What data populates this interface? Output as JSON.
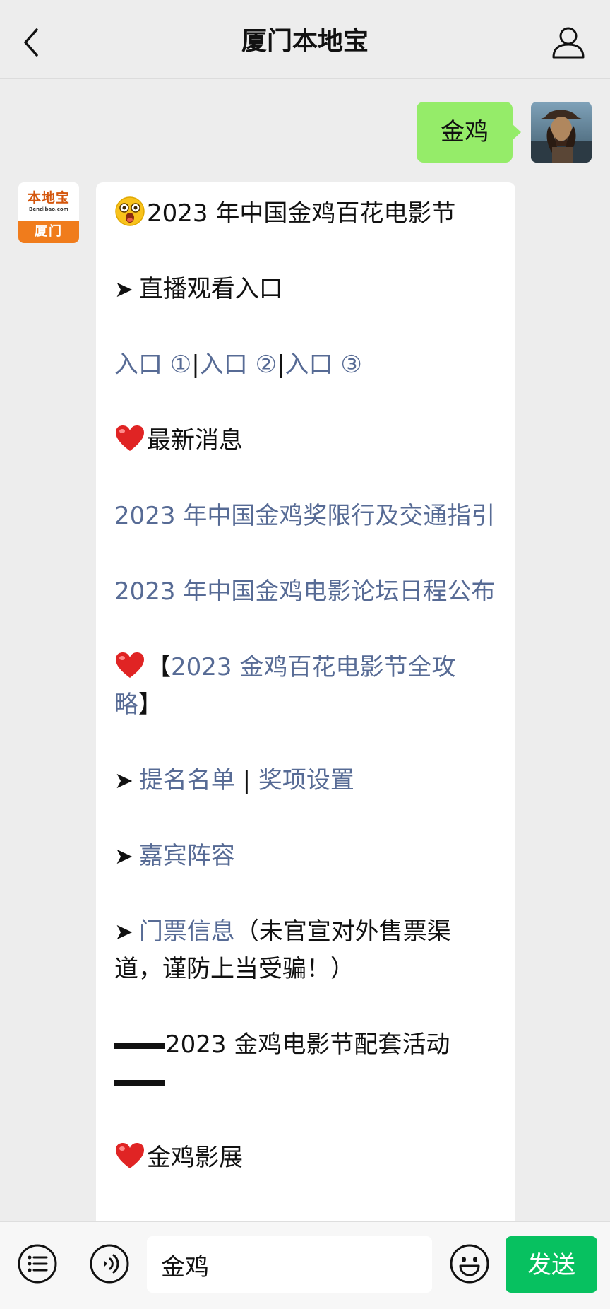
{
  "header": {
    "title": "厦门本地宝",
    "back_icon": "chevron-left-icon",
    "profile_icon": "person-icon"
  },
  "user_message": {
    "text": "金鸡",
    "avatar": "user-avatar-photo",
    "bubble_color": "#95ec69"
  },
  "bot": {
    "avatar_logo_text": "本地宝",
    "avatar_logo_domain": "Bendibao.com",
    "avatar_city": "厦门",
    "accent_orange": "#f07c1c"
  },
  "reply": {
    "title": "2023 年中国金鸡百花电影节",
    "live_heading": "直播观看入口",
    "entries": [
      "入口 ①",
      "入口 ②",
      "入口 ③"
    ],
    "news_heading": "最新消息",
    "news_link_1": "2023 年中国金鸡奖限行及交通指引",
    "news_link_2": "2023 年中国金鸡电影论坛日程公布",
    "guide_open": "【",
    "guide_link": "2023 金鸡百花电影节全攻略",
    "guide_close": "】",
    "nominations": "提名名单",
    "separator": "|",
    "awards": "奖项设置",
    "guests": "嘉宾阵容",
    "tickets": "门票信息",
    "tickets_note": "（未官宣对外售票渠道，谨防上当受骗！）",
    "activities": "2023 金鸡电影节配套活动",
    "exhibition": "金鸡影展",
    "link_color": "#576b95"
  },
  "input_bar": {
    "value": "金鸡",
    "send_label": "发送",
    "menu_icon": "list-icon",
    "voice_icon": "voice-icon",
    "emoji_icon": "smiley-icon",
    "send_color": "#07c160"
  }
}
